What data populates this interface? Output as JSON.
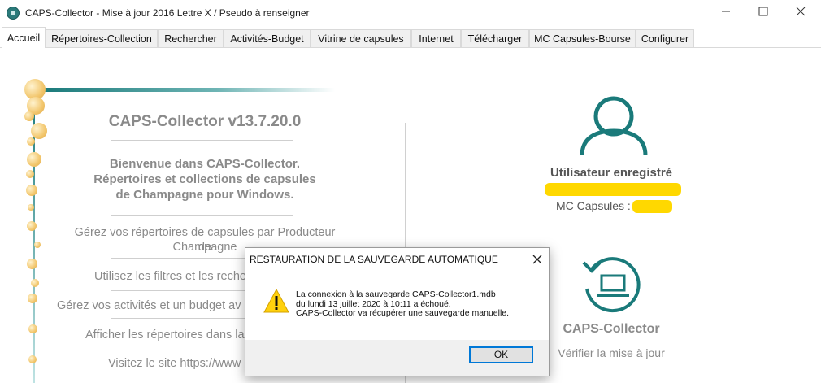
{
  "window": {
    "title": "CAPS-Collector - Mise à jour 2016 Lettre X / Pseudo à renseigner"
  },
  "tabs": [
    "Accueil",
    "Répertoires-Collection",
    "Rechercher",
    "Activités-Budget",
    "Vitrine de capsules",
    "Internet",
    "Télécharger",
    "MC Capsules-Bourse",
    "Configurer"
  ],
  "home": {
    "app_heading": "CAPS-Collector v13.7.20.0",
    "welcome_lines": [
      "Bienvenue dans CAPS-Collector.",
      "Répertoires et collections de capsules",
      "de Champagne pour Windows."
    ],
    "features": [
      "Gérez vos répertoires de capsules par Producteur de",
      "Champagne",
      "Utilisez les filtres et les reche",
      "Gérez vos activités et un budget av",
      "Afficher les répertoires dans la",
      "Visitez le site https://www"
    ],
    "user_label": "Utilisateur enregistré",
    "mc_label": "MC Capsules :",
    "caps_label": "CAPS-Collector",
    "verify_label": "Vérifier la mise à jour",
    "accent_color": "#1a7a7a"
  },
  "dialog": {
    "title": "RESTAURATION DE LA SAUVEGARDE AUTOMATIQUE",
    "icon": "warning-icon",
    "lines": [
      "La connexion à la sauvegarde CAPS-Collector1.mdb",
      "du lundi 13 juillet 2020 à 10:11 a échoué.",
      "CAPS-Collector va récupérer une sauvegarde manuelle."
    ],
    "ok_label": "OK"
  }
}
